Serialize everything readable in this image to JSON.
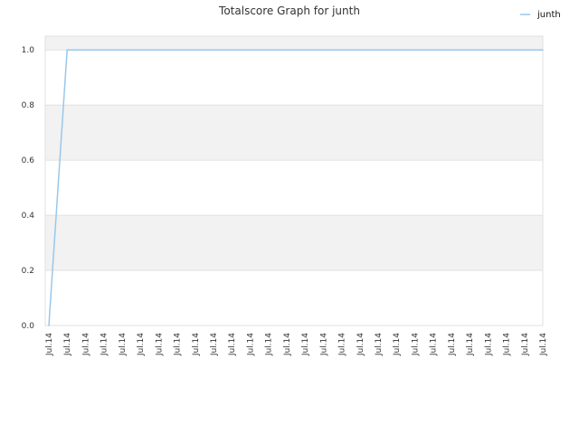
{
  "chart_data": {
    "type": "line",
    "title": "Totalscore Graph for junth",
    "xlabel": "",
    "ylabel": "",
    "x": [
      "Jul.14",
      "Jul.14",
      "Jul.14",
      "Jul.14",
      "Jul.14",
      "Jul.14",
      "Jul.14",
      "Jul.14",
      "Jul.14",
      "Jul.14",
      "Jul.14",
      "Jul.14",
      "Jul.14",
      "Jul.14",
      "Jul.14",
      "Jul.14",
      "Jul.14",
      "Jul.14",
      "Jul.14",
      "Jul.14",
      "Jul.14",
      "Jul.14",
      "Jul.14",
      "Jul.14",
      "Jul.14",
      "Jul.14",
      "Jul.14",
      "Jul.14"
    ],
    "series": [
      {
        "name": "junth",
        "values": [
          0,
          1,
          1,
          1,
          1,
          1,
          1,
          1,
          1,
          1,
          1,
          1,
          1,
          1,
          1,
          1,
          1,
          1,
          1,
          1,
          1,
          1,
          1,
          1,
          1,
          1,
          1,
          1
        ]
      }
    ],
    "ylim": [
      0,
      1.05
    ],
    "yticks": [
      "0.0",
      "0.2",
      "0.4",
      "0.6",
      "0.8",
      "1.0"
    ],
    "grid": true,
    "legend": "top-right",
    "colors": {
      "line": "#99c7ea",
      "band": "#f2f2f2",
      "gridline": "#e0e0e0",
      "axis": "#cccccc"
    }
  }
}
